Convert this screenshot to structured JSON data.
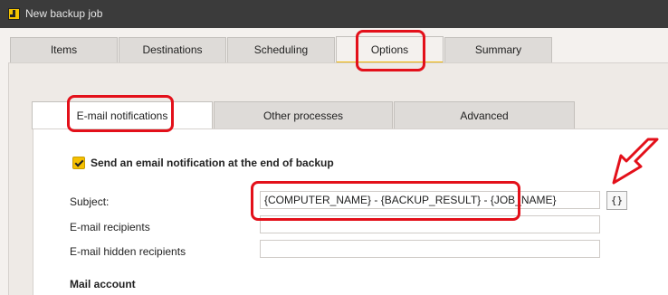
{
  "window": {
    "title": "New backup job"
  },
  "tabs": [
    {
      "label": "Items"
    },
    {
      "label": "Destinations"
    },
    {
      "label": "Scheduling"
    },
    {
      "label": "Options"
    },
    {
      "label": "Summary"
    }
  ],
  "subtabs": [
    {
      "label": "E-mail notifications"
    },
    {
      "label": "Other processes"
    },
    {
      "label": "Advanced"
    }
  ],
  "form": {
    "send_email_checkbox": {
      "label": "Send an email notification at the end of backup",
      "checked": true
    },
    "subject_label": "Subject:",
    "subject_value": "{COMPUTER_NAME} - {BACKUP_RESULT} - {JOB_NAME}",
    "variables_button_label": "{}",
    "recipients_label": "E-mail recipients",
    "recipients_value": "",
    "hidden_recipients_label": "E-mail hidden recipients",
    "hidden_recipients_value": "",
    "mail_account_heading": "Mail account"
  },
  "colors": {
    "accent": "#f0b400",
    "annotation": "#e3101a",
    "titlebar": "#3b3b3b"
  }
}
